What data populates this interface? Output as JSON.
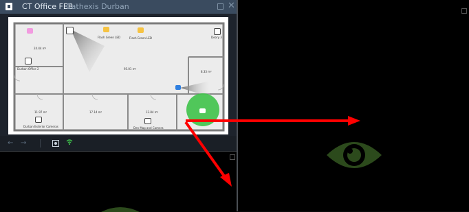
{
  "window": {
    "title": "CT Office FEB",
    "subtitle": "Cathexis Durban",
    "maximize_icon": "maximize-icon",
    "close_glyph": "✕"
  },
  "floorplan": {
    "rooms": [
      {
        "area": "24.44 m²",
        "name": "Durban Office 2"
      },
      {
        "area": "95.01 m²",
        "name": ""
      },
      {
        "area": "8.33 m²",
        "name": ""
      },
      {
        "area": "11.97 m²",
        "name": "Durban Exterior Cameras"
      },
      {
        "area": "17.14 m²",
        "name": ""
      },
      {
        "area": "12.84 m²",
        "name": "Den Map and Camera"
      }
    ],
    "devices": [
      {
        "label": "Flash Green LED",
        "icon": "led-icon"
      },
      {
        "label": "Flash Green LED",
        "icon": "led-icon"
      },
      {
        "label": "Deory 3",
        "icon": "device-icon"
      }
    ]
  },
  "toolbar": {
    "back_glyph": "←",
    "forward_glyph": "→",
    "fit_icon": "fit-view-icon",
    "network_icon": "wifi-icon"
  },
  "colors": {
    "titlebar": "#3a4b5f",
    "camera_cone": "#8d8d8d",
    "alarm_zone": "#3fc34a",
    "arrow": "#ff0000",
    "eye": "#2c4a1c"
  }
}
